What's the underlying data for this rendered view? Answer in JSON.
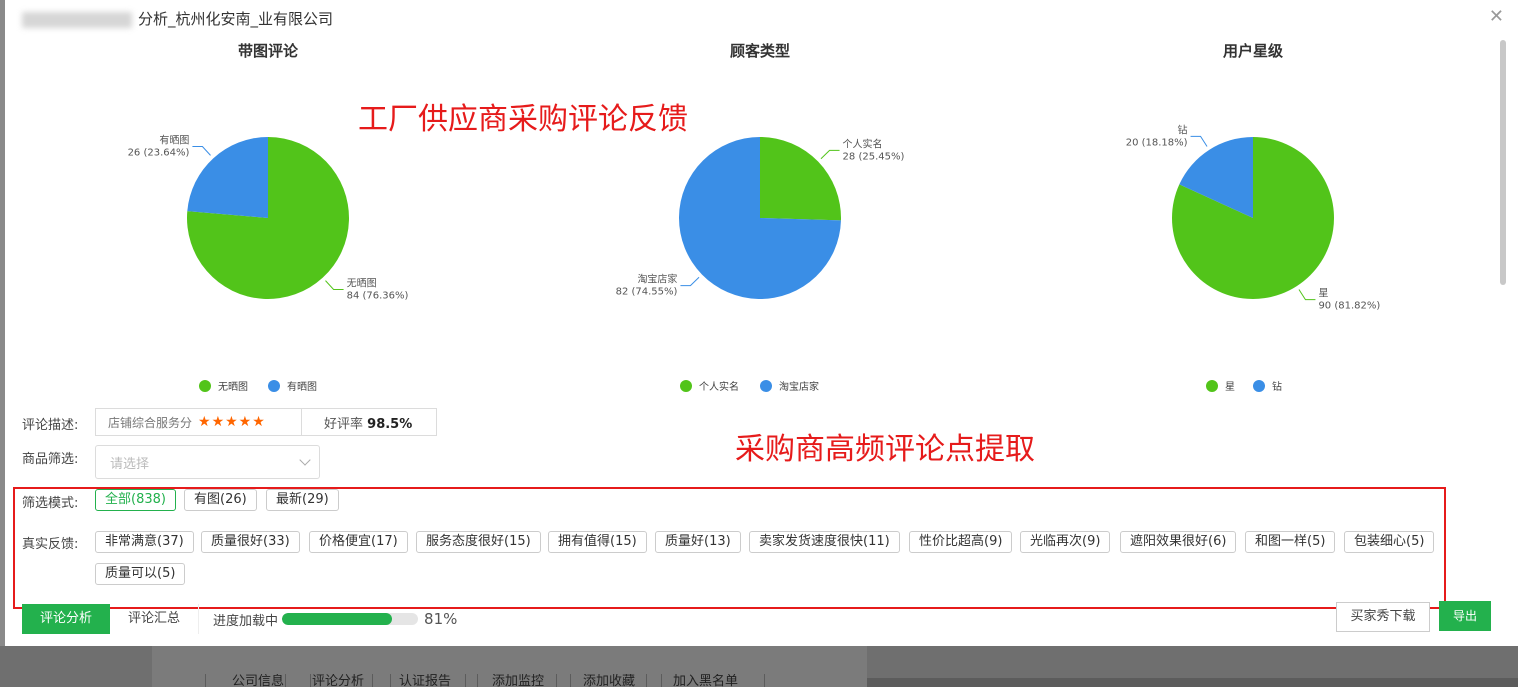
{
  "modal": {
    "title_visible": "分析_杭州化安南_业有限公司",
    "close_icon": "close-icon"
  },
  "charts": [
    {
      "title": "带图评论",
      "slices": [
        {
          "name": "无晒图",
          "value": 84,
          "pct": "76.36%",
          "color": "#52c41a"
        },
        {
          "name": "有晒图",
          "value": 26,
          "pct": "23.64%",
          "color": "#3a8ee6"
        }
      ],
      "legend": [
        "无晒图",
        "有晒图"
      ]
    },
    {
      "title": "顾客类型",
      "slices": [
        {
          "name": "个人实名",
          "value": 28,
          "pct": "25.45%",
          "color": "#52c41a"
        },
        {
          "name": "淘宝店家",
          "value": 82,
          "pct": "74.55%",
          "color": "#3a8ee6"
        }
      ],
      "legend": [
        "个人实名",
        "淘宝店家"
      ]
    },
    {
      "title": "用户星级",
      "slices": [
        {
          "name": "星",
          "value": 90,
          "pct": "81.82%",
          "color": "#52c41a"
        },
        {
          "name": "钻",
          "value": 20,
          "pct": "18.18%",
          "color": "#3a8ee6"
        }
      ],
      "legend": [
        "星",
        "钻"
      ]
    }
  ],
  "chart_data": [
    {
      "type": "pie",
      "title": "带图评论",
      "categories": [
        "无晒图",
        "有晒图"
      ],
      "values": [
        84,
        26
      ]
    },
    {
      "type": "pie",
      "title": "顾客类型",
      "categories": [
        "个人实名",
        "淘宝店家"
      ],
      "values": [
        28,
        82
      ]
    },
    {
      "type": "pie",
      "title": "用户星级",
      "categories": [
        "星",
        "钻"
      ],
      "values": [
        90,
        20
      ]
    }
  ],
  "annotations": {
    "top": "工厂供应商采购评论反馈",
    "middle": "采购商高频评论点提取"
  },
  "review": {
    "desc_label": "评论描述:",
    "shop_score_label": "店铺综合服务分",
    "stars": "★★★★★",
    "good_rate_label": "好评率",
    "good_rate_value": "98.5%"
  },
  "product_filter": {
    "label": "商品筛选:",
    "placeholder": "请选择"
  },
  "filter_mode": {
    "label": "筛选模式:",
    "options": [
      "全部(838)",
      "有图(26)",
      "最新(29)"
    ]
  },
  "feedback": {
    "label": "真实反馈:",
    "tags": [
      "非常满意(37)",
      "质量很好(33)",
      "价格便宜(17)",
      "服务态度很好(15)",
      "拥有值得(15)",
      "质量好(13)",
      "卖家发货速度很快(11)",
      "性价比超高(9)",
      "光临再次(9)",
      "遮阳效果很好(6)",
      "和图一样(5)",
      "包装细心(5)",
      "质量可以(5)"
    ]
  },
  "tabs": {
    "active": "评论分析",
    "second": "评论汇总",
    "progress_label": "进度加载中",
    "progress_value": 81,
    "progress_text": "81%"
  },
  "buttons": {
    "download": "买家秀下载",
    "export": "导出"
  },
  "bottom_tabs": [
    "公司信息",
    "评论分析",
    "认证报告",
    "添加监控",
    "添加收藏",
    "加入黑名单"
  ]
}
